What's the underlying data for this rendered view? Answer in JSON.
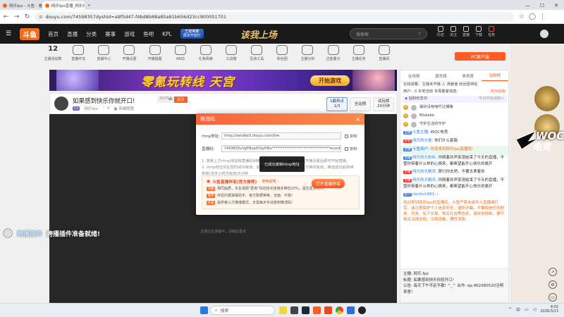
{
  "browser": {
    "tabs": [
      {
        "label": "网乐fpx - 斗鱼 - 看见每种热爱",
        "active": false
      },
      {
        "label": "网乐fpx直播_网乐fpx直播 网乐",
        "active": true
      }
    ],
    "new_tab": "+",
    "url": "douyu.com/74598357dyshid=a9f5d47-f4bd8b88a85a81b656d23cc900051701"
  },
  "site": {
    "logo": "斗鱼",
    "nav": [
      "首页",
      "直播",
      "分类",
      "赛事",
      "游戏",
      "鱼吧",
      "KPL"
    ],
    "king_btn": [
      "王者荣耀",
      "周末开放打"
    ],
    "banner_text": "该我上场",
    "search_placeholder": "搜索框",
    "header_icons": [
      "历史",
      "关注",
      "直播",
      "下载",
      "任务"
    ]
  },
  "categories": [
    {
      "label": "主播活动数",
      "num": "12"
    },
    {
      "label": "直播开关",
      "num": ""
    },
    {
      "label": "直播中心",
      "num": ""
    },
    {
      "label": "开播设置",
      "num": ""
    },
    {
      "label": "开播提醒",
      "num": ""
    },
    {
      "label": "AR动",
      "num": ""
    },
    {
      "label": "礼物贡献",
      "num": ""
    },
    {
      "label": "工具箱",
      "num": ""
    },
    {
      "label": "互动工具",
      "num": ""
    },
    {
      "label": "粉丝团",
      "num": ""
    },
    {
      "label": "主播分析",
      "num": ""
    },
    {
      "label": "正能量分",
      "num": ""
    },
    {
      "label": "主播任务",
      "num": ""
    },
    {
      "label": "直播间",
      "num": ""
    }
  ],
  "pc_button": "PC客户端",
  "ad": {
    "title": "零氪玩转线 天宫",
    "button": "开始游戏"
  },
  "room": {
    "title": "如果感到快乐你就开口!",
    "room_id": "30754",
    "follow_count": "0",
    "follow_label": "关注",
    "level": "Lv",
    "streamer": "网乐fpx",
    "viewers": "0",
    "category": "英雄联盟",
    "btn_lines": [
      "1最热点",
      "1/3"
    ],
    "btn_all": "全站榜",
    "btn_try": [
      "试玩榜",
      "20分钟"
    ]
  },
  "video_message": "主播正在准备中，请稍后重试",
  "plugin": {
    "name": "跨播插件",
    "message": "跨播插件准备就绪!"
  },
  "modal": {
    "title": "推流码",
    "close": "×",
    "rtmp_label": "rtmp地址:",
    "rtmp_value": "rtmp://sendtw3.douyu.com/live",
    "key_label": "直播码:",
    "key_value": "7459835yVgFNxqXYdyP8lx*********************************ecord=flv&rcenco",
    "copy": "复制",
    "tips": [
      "1. 复制上方rtmp地址和直播码到推流软件，参考开播教程完成开播设置后即可开始直播。",
      "2. rtmp地址仅在短时间内有效，如更改请重新获取，直播码五分钟内有效，推流成功后持续有效(当天小时内有效)5分钟"
    ],
    "promo_title": "斗鱼直播伴侣(官方推荐)",
    "promo_link": "使用说明 ›",
    "promo_items": [
      {
        "tag": "流畅",
        "text": "相同画质，本友视频\"更爽\"码控技术连接多降低20%，留住更多观众!"
      },
      {
        "tag": "简单",
        "text": "伴侣内置弹幕助手、官方数据等等、全面、可靠!"
      },
      {
        "tag": "升级",
        "text": "提供第三方推播模式，无需每天手动复制推流码!"
      }
    ],
    "open_tool": "打开直播伴侣"
  },
  "toast": "已成功复制rtmp地址",
  "side": {
    "rank_tabs": [
      "在线榜",
      "周贡榜",
      "贵宾席",
      "钻粉榜"
    ],
    "rank_active": 3,
    "top_notes": [
      "在线观看：主播未开播 人 贡献值 粉丝团排名",
      "用户：0 本地当前 本周看客信息：",
      "成为钻粉"
    ],
    "anniversary": "钻粉纪念日",
    "anniversary_note": "今日开启成就>",
    "fans": [
      {
        "rank": "1",
        "name": "最好没有啥吓过播猪"
      },
      {
        "rank": "2",
        "name": "Bilalabo"
      },
      {
        "rank": "3",
        "name": "守护生活的守护"
      }
    ],
    "chats": [
      {
        "badge": "主播",
        "nick": "斗鱼主播",
        "text": "WOC电竞"
      },
      {
        "badge": "房管",
        "nick": "网乐的大佬",
        "text": "你们什么套路"
      },
      {
        "badge": "主播",
        "nick": "斗鱼用户",
        "text": "欢迎来到网乐fpx直播间!"
      },
      {
        "badge": "主播",
        "nick": "网乐的大粉丝",
        "text": "你随着欢声笑语结束了今天的直播，不管你带着什么样的心情来，都希望能开心快乐的离开"
      },
      {
        "badge": "主播",
        "nick": "网乐的大精灵",
        "text": "那行你去吧，不要太拿着你"
      },
      {
        "badge": "主播",
        "nick": "网乐的大精灵",
        "text": "你随着欢声笑语结束了今天的直播，不管你带着什么样的心情来，都希望能开心快乐的离开"
      },
      {
        "badge": "新人",
        "nick": "jianXu1991",
        "text": ":"
      }
    ],
    "system_notice": "欢迎来到网乐fpx的直播间，斗鱼严禁未成年人直播或打赏，请注意保护个人信息安全，谨防诈骗，不要相信任何刷单、代充、私下交易、购买礼包等信息，请自觉抵制，遵守相关法律法规，文明观看，理性消费。",
    "notice_host": "主播: 网乐.fpx",
    "notice_title": "标题: 如果感到快乐你就开口!",
    "notice_text": "公告: 每天下午不定不散!  ^_^ 合作: qq 962380520注明来意!"
  },
  "watermark": {
    "en": "WOC",
    "cn": "电竞"
  },
  "taskbar": {
    "search": "搜索",
    "tray_lang": "中",
    "time": "9:02",
    "date": "2026/3/13"
  }
}
